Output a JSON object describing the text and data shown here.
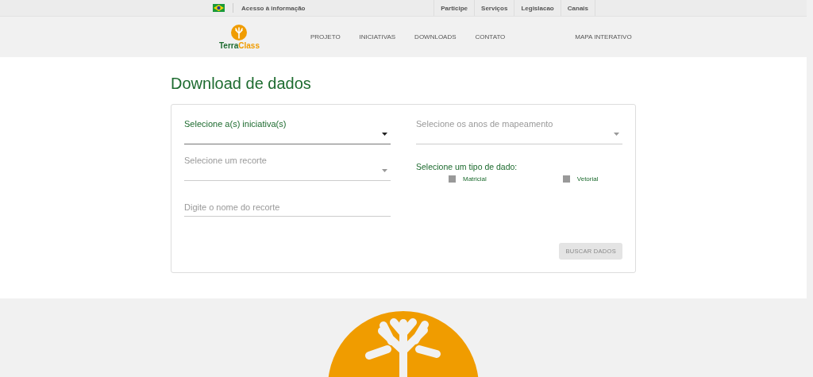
{
  "gov_bar": {
    "access_link": "Acesso à informação",
    "links": [
      "Participe",
      "Serviços",
      "Legislacao",
      "Canais"
    ]
  },
  "header": {
    "logo": {
      "part_1": "Terra",
      "part_2": "Class"
    },
    "nav": [
      "PROJETO",
      "INICIATIVAS",
      "DOWNLOADS",
      "CONTATO",
      "MAPA INTERATIVO"
    ]
  },
  "page_title": "Download de dados",
  "form": {
    "left_fields": [
      {
        "kind": "select",
        "label": "Selecione a(s) iniciativa(s)",
        "focused": true
      },
      {
        "kind": "select",
        "label": "Selecione um recorte",
        "focused": false
      },
      {
        "kind": "text",
        "placeholder": "Digite o nome do recorte",
        "focused": false
      }
    ],
    "right_fields": [
      {
        "kind": "select",
        "label": "Selecione os anos de mapeamento",
        "focused": false
      }
    ],
    "data_type": {
      "title": "Selecione um tipo de dado:",
      "options": [
        {
          "label": "Matricial",
          "checked": false
        },
        {
          "label": "Vetorial",
          "checked": false
        }
      ]
    },
    "submit": {
      "label": "BUSCAR DADOS",
      "disabled": true
    }
  }
}
